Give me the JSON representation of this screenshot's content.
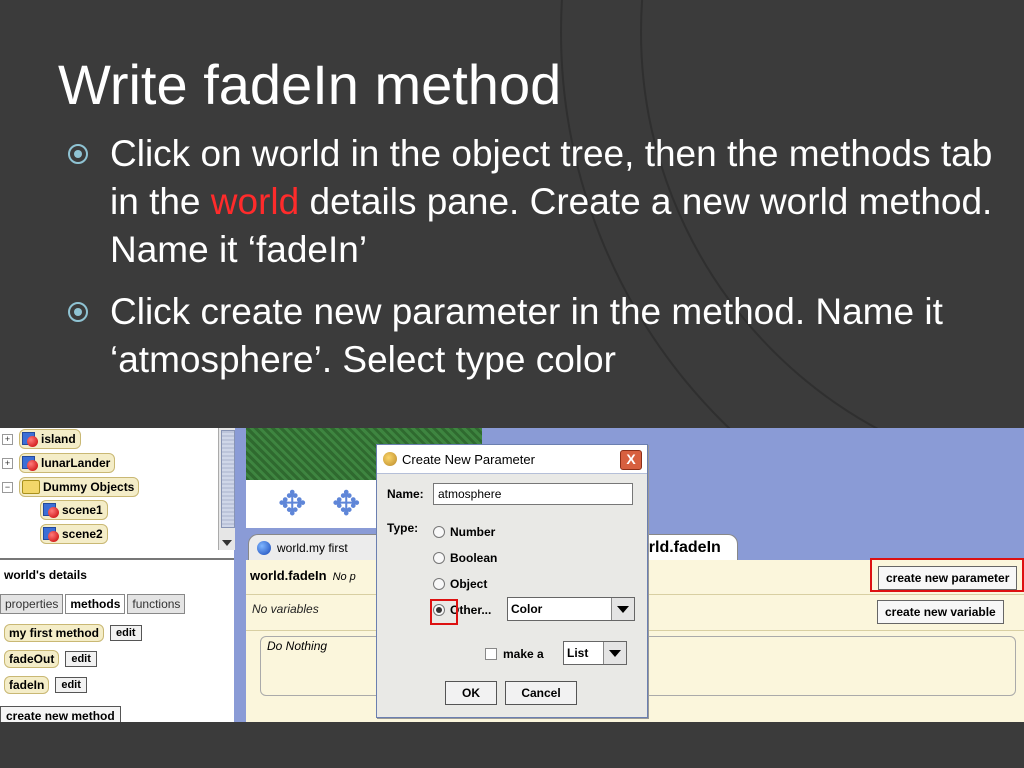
{
  "slide": {
    "title": "Write fadeIn method",
    "bullets": [
      {
        "before": "Click on world in the object tree, then the methods tab in the ",
        "highlight": "world",
        "after": " details pane. Create a new world method. Name it ‘fadeIn’"
      },
      {
        "text": "Click create new parameter in the method. Name it ‘atmosphere’. Select type color"
      }
    ],
    "colors": {
      "background": "#3b3b3b",
      "text": "#ffffff",
      "highlight": "#ff2b2b",
      "bullet": "#8fc3d3"
    }
  },
  "object_tree": {
    "items": [
      {
        "label": "island",
        "icon": "object-icon",
        "expander": "+"
      },
      {
        "label": "lunarLander",
        "icon": "object-icon",
        "expander": "+"
      },
      {
        "label": "Dummy Objects",
        "icon": "folder-icon",
        "expander": "−"
      },
      {
        "label": "scene1",
        "icon": "object-icon",
        "expander": ""
      },
      {
        "label": "scene2",
        "icon": "object-icon",
        "expander": ""
      }
    ]
  },
  "details": {
    "title": "world's details",
    "tabs": [
      "properties",
      "methods",
      "functions"
    ],
    "active_tab": "methods",
    "methods": [
      {
        "name": "my first method",
        "edit": "edit"
      },
      {
        "name": "fadeOut",
        "edit": "edit"
      },
      {
        "name": "fadeIn",
        "edit": "edit"
      }
    ],
    "create_button": "create new method"
  },
  "editor": {
    "tabs": [
      "world.my first",
      "orld.fadeIn"
    ],
    "method_header": "world.fadeIn",
    "params_hint": "No p",
    "no_variables": "No variables",
    "do_nothing": "Do Nothing",
    "create_param_button": "create new parameter",
    "create_var_button": "create new variable"
  },
  "dialog": {
    "title": "Create New Parameter",
    "name_label": "Name:",
    "name_value": "atmosphere",
    "type_label": "Type:",
    "types": [
      "Number",
      "Boolean",
      "Object",
      "Other..."
    ],
    "selected_type": "Other...",
    "other_value": "Color",
    "make_a_label": "make a",
    "list_value": "List",
    "ok": "OK",
    "cancel": "Cancel",
    "close": "X"
  }
}
